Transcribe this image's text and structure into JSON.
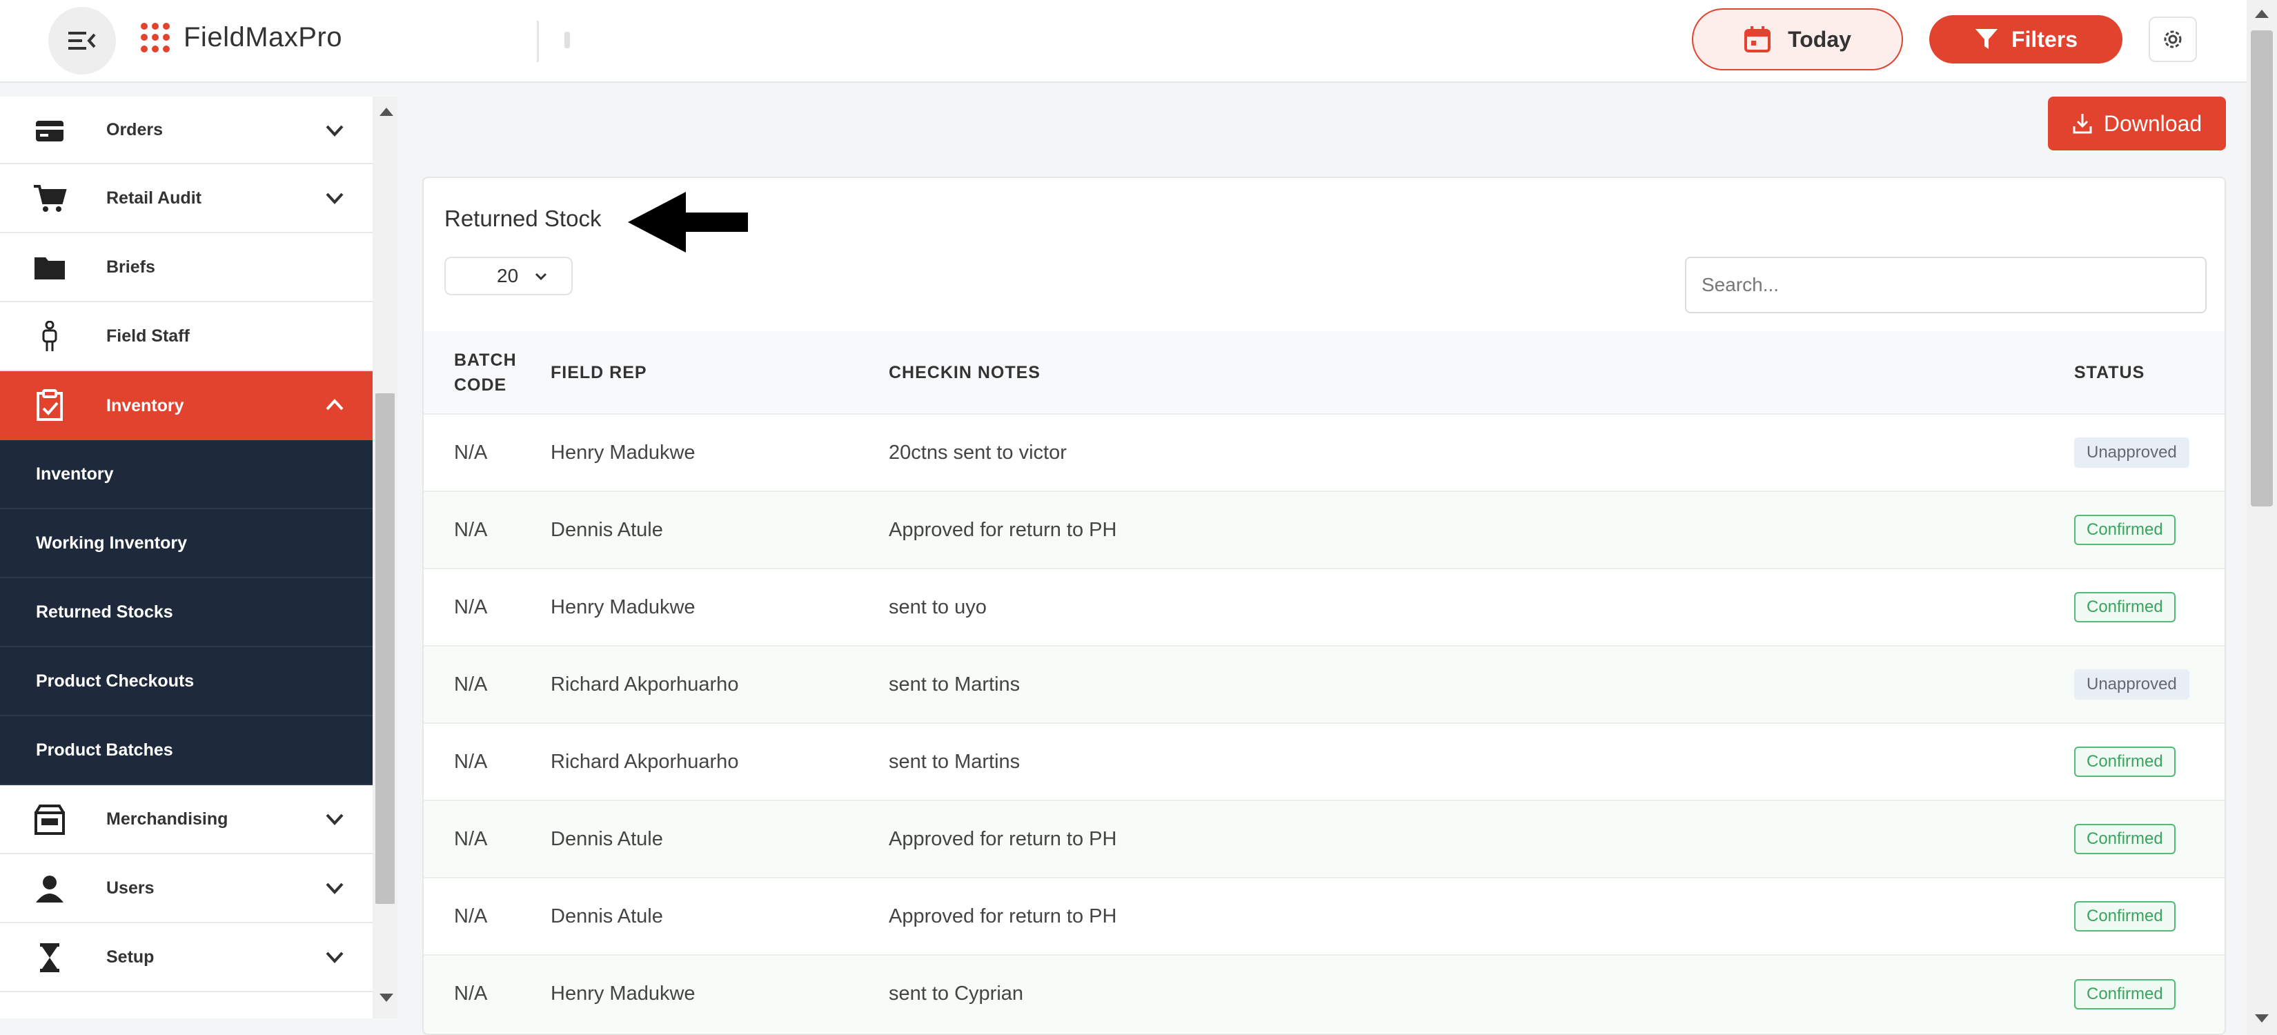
{
  "app": {
    "name": "FieldMaxPro",
    "brand_color": "#e2432f"
  },
  "header": {
    "today_label": "Today",
    "filters_label": "Filters"
  },
  "sidebar": {
    "items": [
      {
        "label": "Orders",
        "icon": "card-icon",
        "expandable": true
      },
      {
        "label": "Retail Audit",
        "icon": "cart-icon",
        "expandable": true
      },
      {
        "label": "Briefs",
        "icon": "folder-icon",
        "expandable": false
      },
      {
        "label": "Field Staff",
        "icon": "person-icon",
        "expandable": false
      },
      {
        "label": "Inventory",
        "icon": "clipboard-check-icon",
        "expandable": true,
        "active": true
      },
      {
        "label": "Merchandising",
        "icon": "store-icon",
        "expandable": true
      },
      {
        "label": "Users",
        "icon": "user-icon",
        "expandable": true
      },
      {
        "label": "Setup",
        "icon": "hourglass-icon",
        "expandable": true
      }
    ],
    "inventory_submenu": [
      "Inventory",
      "Working Inventory",
      "Returned Stocks",
      "Product Checkouts",
      "Product Batches"
    ]
  },
  "toolbar": {
    "download_label": "Download"
  },
  "card": {
    "title": "Returned Stock",
    "per_page": "20",
    "search_placeholder": "Search..."
  },
  "table": {
    "headers": [
      "BATCH CODE",
      "FIELD REP",
      "CHECKIN NOTES",
      "STATUS"
    ],
    "rows": [
      {
        "batch": "N/A",
        "rep": "Henry Madukwe",
        "notes": "20ctns sent to victor",
        "status": "Unapproved"
      },
      {
        "batch": "N/A",
        "rep": "Dennis Atule",
        "notes": "Approved for return to PH",
        "status": "Confirmed"
      },
      {
        "batch": "N/A",
        "rep": "Henry Madukwe",
        "notes": "sent to uyo",
        "status": "Confirmed"
      },
      {
        "batch": "N/A",
        "rep": "Richard Akporhuarho",
        "notes": "sent to Martins",
        "status": "Unapproved"
      },
      {
        "batch": "N/A",
        "rep": "Richard Akporhuarho",
        "notes": "sent to Martins",
        "status": "Confirmed"
      },
      {
        "batch": "N/A",
        "rep": "Dennis Atule",
        "notes": "Approved for return to PH",
        "status": "Confirmed"
      },
      {
        "batch": "N/A",
        "rep": "Dennis Atule",
        "notes": "Approved for return to PH",
        "status": "Confirmed"
      },
      {
        "batch": "N/A",
        "rep": "Henry Madukwe",
        "notes": "sent to Cyprian",
        "status": "Confirmed"
      }
    ]
  }
}
